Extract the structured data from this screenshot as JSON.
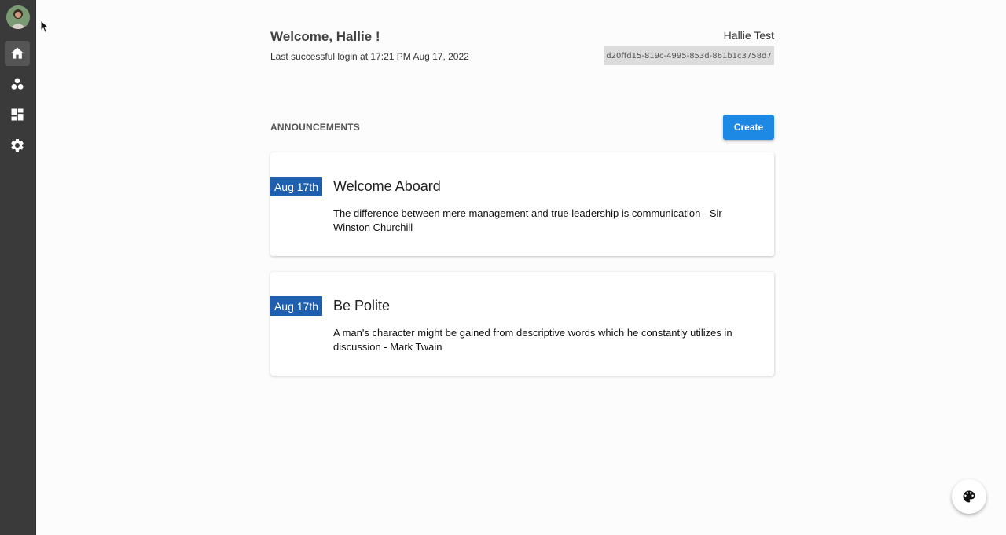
{
  "sidebar": {
    "items": [
      {
        "icon": "home-icon"
      },
      {
        "icon": "people-icon"
      },
      {
        "icon": "dashboard-icon"
      },
      {
        "icon": "gear-icon"
      }
    ]
  },
  "header": {
    "welcome": "Welcome, Hallie !",
    "last_login": "Last successful login at 17:21 PM Aug 17, 2022",
    "user_name": "Hallie Test",
    "user_id": "d20ffd15-819c-4995-853d-861b1c3758d7"
  },
  "announcements": {
    "title": "ANNOUNCEMENTS",
    "create_label": "Create",
    "items": [
      {
        "date": "Aug 17th",
        "title": "Welcome Aboard",
        "body": "The difference between mere management and true leadership is communication - Sir Winston Churchill"
      },
      {
        "date": "Aug 17th",
        "title": "Be Polite",
        "body": "A man's character might be gained from descriptive words which he constantly utilizes in discussion - Mark Twain"
      }
    ]
  },
  "colors": {
    "sidebar_bg": "#3a3a3a",
    "accent": "#1e88e5",
    "date_badge": "#1f5fb0"
  }
}
